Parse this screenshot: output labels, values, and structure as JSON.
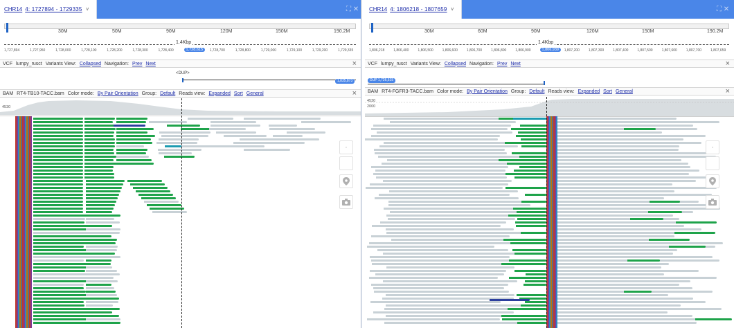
{
  "left": {
    "chrom": "CHR14",
    "locus": "4: 1727894 - 1729335",
    "caret": "v",
    "window_controls": "⛶ ✕",
    "mb_labels": [
      "30M",
      "50M",
      "90M",
      "120M",
      "150M",
      "190.2M"
    ],
    "ideo_start": "10",
    "span_label": "1.4Kbp",
    "ruler_ticks": [
      "1,727,894",
      "1,727,950",
      "1,728,000",
      "1,728,100",
      "1,728,200",
      "1,728,300",
      "1,728,400",
      "1,728,615",
      "1,728,700",
      "1,728,800",
      "1,729,000",
      "1,729,100",
      "1,729,200",
      "1,729,335"
    ],
    "ruler_highlight_index": 7,
    "vcf_header": {
      "type": "VCF",
      "name": "lumpy_rusct",
      "variants_view_label": "Variants View:",
      "variants_view_value": "Collapsed",
      "navigation_label": "Navigation:",
      "prev": "Prev",
      "next": "Next"
    },
    "dup_label": "<DUP>",
    "vcf_end_pill": "1,835,873",
    "bam_header": {
      "type": "BAM",
      "name": "RT4-TB10-TACC.bam",
      "color_mode_label": "Color mode:",
      "color_mode_value": "By Pair Orientation",
      "group_label": "Group:",
      "group_value": "Default",
      "reads_view_label": "Reads view:",
      "reads_view_value": "Expanded",
      "sort": "Sort",
      "general": "General"
    },
    "coverage_max": "4530",
    "close": "×"
  },
  "right": {
    "chrom": "CHR14",
    "locus": "4: 1806218 - 1807659",
    "caret": "v",
    "window_controls": "⛶ ✕",
    "mb_labels": [
      "30M",
      "60M",
      "90M",
      "120M",
      "150M",
      "190.2M"
    ],
    "ideo_start": "10",
    "span_label": "1.4Kbp",
    "ruler_ticks": [
      "1,806,218",
      "1,806,400",
      "1,806,500",
      "1,806,600",
      "1,806,700",
      "1,806,800",
      "1,806,900",
      "1,806,939",
      "1,807,200",
      "1,807,300",
      "1,807,400",
      "1,807,500",
      "1,807,600",
      "1,807,700",
      "1,807,659"
    ],
    "ruler_highlight_index": 7,
    "vcf_header": {
      "type": "VCF",
      "name": "lumpy_rusct",
      "variants_view_label": "Variants View:",
      "variants_view_value": "Collapsed",
      "navigation_label": "Navigation:",
      "prev": "Prev",
      "next": "Next"
    },
    "vcf_start_pill": "DUP 1,726,515",
    "bam_header": {
      "type": "BAM",
      "name": "RT4-FGFR3-TACC.bam",
      "color_mode_label": "Color mode:",
      "color_mode_value": "By Pair Orientation",
      "group_label": "Group:",
      "group_value": "Default",
      "reads_view_label": "Reads view:",
      "reads_view_value": "Expanded",
      "sort": "Sort",
      "general": "General"
    },
    "coverage_max": "4530",
    "coverage_mid": "2000",
    "close": "×"
  },
  "icons": {
    "pin": "map-pin-icon",
    "camera": "camera-icon",
    "fullscreen": "fullscreen-icon",
    "close": "close-icon"
  },
  "colors": {
    "accent": "#4a86e8",
    "read_grey": "#c8d1d6",
    "read_green": "#1ea34a",
    "read_blue": "#2c3f9e",
    "read_teal": "#1a9bb0"
  }
}
